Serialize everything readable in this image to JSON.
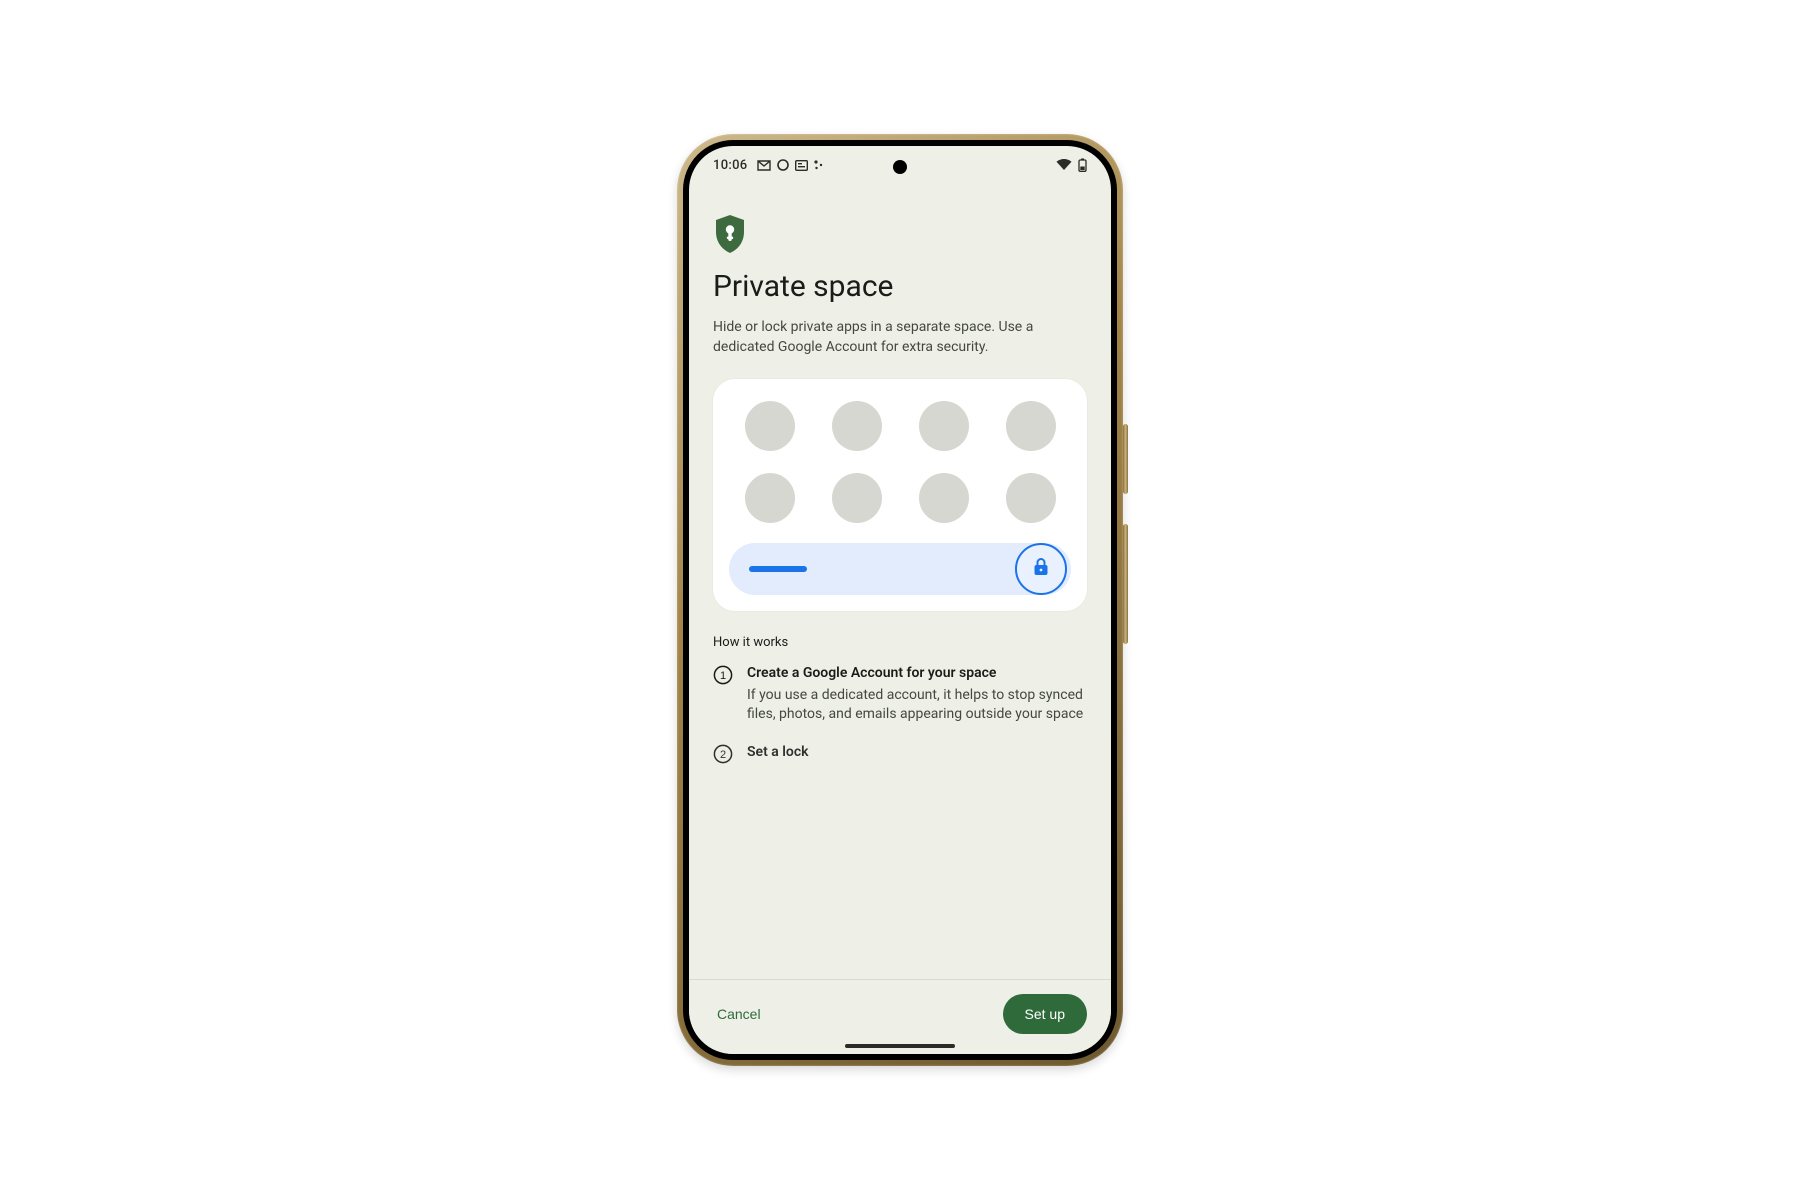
{
  "status": {
    "time": "10:06",
    "icons_left": [
      "gmail-icon",
      "circle-icon",
      "news-icon",
      "more-icon"
    ],
    "icons_right": [
      "wifi-icon",
      "battery-icon"
    ]
  },
  "header": {
    "title": "Private space",
    "subtitle": "Hide or lock private apps in a separate space. Use a dedicated Google Account for extra security."
  },
  "how_it_works": {
    "label": "How it works",
    "steps": [
      {
        "num": "1",
        "title": "Create a Google Account for your space",
        "body": "If you use a dedicated account, it helps to stop synced files, photos, and emails appearing outside your space"
      },
      {
        "num": "2",
        "title": "Set a lock",
        "body": ""
      }
    ]
  },
  "actions": {
    "cancel": "Cancel",
    "primary": "Set up"
  },
  "colors": {
    "accent_blue": "#1a73e8",
    "action_green": "#2f6b3a",
    "background": "#eef0e7"
  }
}
